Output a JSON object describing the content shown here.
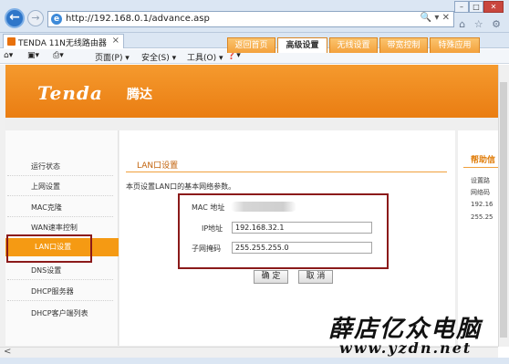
{
  "browser": {
    "url": "http://192.168.0.1/advance.asp",
    "url_tools": "🔍 ▾ ✕",
    "tab_title": "TENDA 11N无线路由器",
    "tab_close": "×",
    "back": "←",
    "forward": "→",
    "window_buttons": [
      "–",
      "□",
      "✕"
    ],
    "right_icons": "⌂ ☆ ⚙",
    "command_bar": [
      "▾",
      "▾",
      "▾",
      "页面(P) ▾",
      "安全(S) ▾",
      "工具(O) ▾",
      "❓▾"
    ]
  },
  "header": {
    "brand": "Tenda",
    "brand_cn": "腾达",
    "nav_tabs": [
      "返回首页",
      "高级设置",
      "无线设置",
      "带宽控制",
      "特殊应用"
    ],
    "active_tab": "高级设置",
    "brand_color": "#f08a1e"
  },
  "sidebar": {
    "items": [
      "运行状态",
      "上网设置",
      "MAC克隆",
      "WAN速率控制",
      "LAN口设置",
      "DNS设置",
      "DHCP服务器",
      "DHCP客户端列表"
    ],
    "active": "LAN口设置"
  },
  "main": {
    "section_title": "LAN口设置",
    "description": "本页设置LAN口的基本网络参数。",
    "mac_label": "MAC 地址",
    "ip_label": "IP地址",
    "ip_value": "192.168.32.1",
    "mask_label": "子网掩码",
    "mask_value": "255.255.255.0",
    "ok_button": "确 定",
    "cancel_button": "取 消"
  },
  "help": {
    "title": "帮助信",
    "lines": [
      "设置路",
      "网络码",
      "192.16",
      "255.25"
    ]
  },
  "watermark": {
    "text": "薛店亿众电脑",
    "url": "www.yzdn.net"
  },
  "scroll": {
    "left_arrow": "<"
  }
}
